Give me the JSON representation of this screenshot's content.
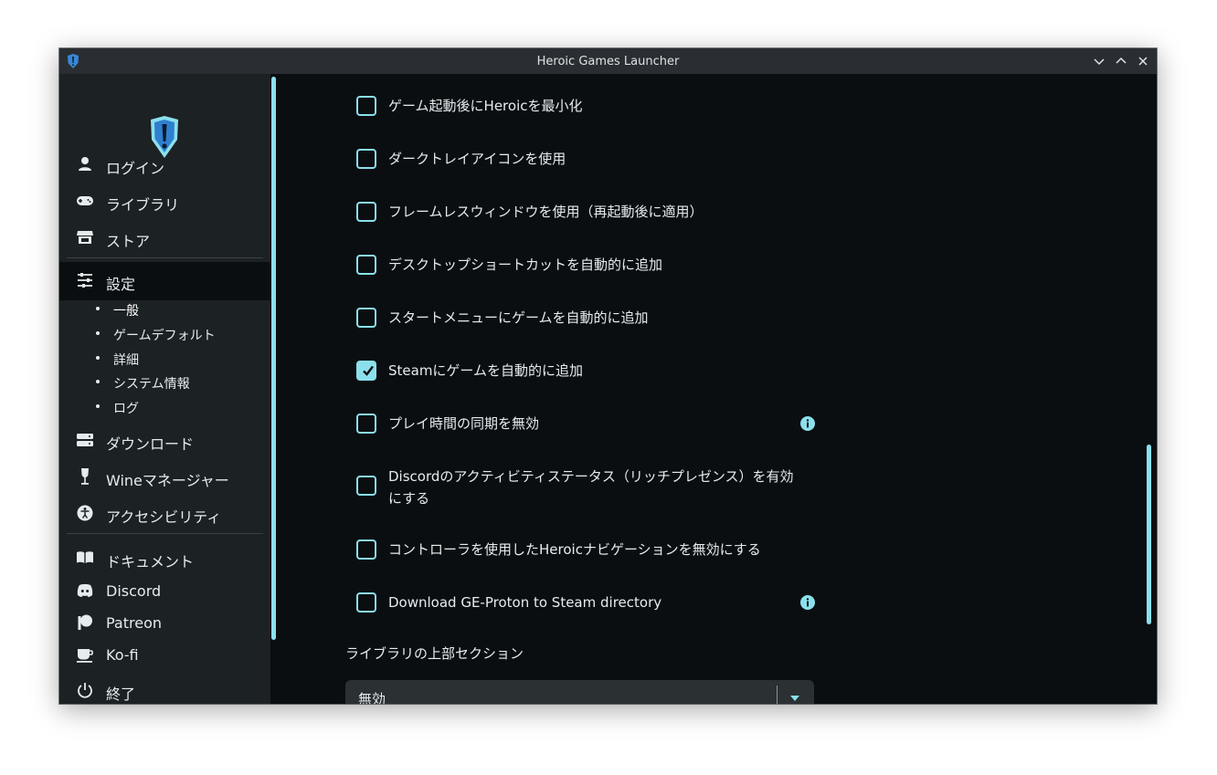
{
  "window": {
    "title": "Heroic Games Launcher",
    "app_icon": "heroic-shield-icon",
    "controls": [
      "minimize-icon",
      "maximize-icon",
      "close-icon"
    ]
  },
  "colors": {
    "accent": "#8be0ec",
    "sidebar_bg": "#1c2123",
    "main_bg": "#0b0e11",
    "titlebar_bg": "#2a2e32",
    "text": "#e6ecee"
  },
  "sidebar": {
    "logo": "heroic-logo-icon",
    "nav": [
      {
        "label": "ログイン",
        "icon": "user-icon"
      },
      {
        "label": "ライブラリ",
        "icon": "gamepad-icon"
      },
      {
        "label": "ストア",
        "icon": "store-icon"
      },
      {
        "label": "設定",
        "icon": "sliders-icon",
        "active": true
      }
    ],
    "settings_sub": [
      {
        "label": "一般",
        "active": true
      },
      {
        "label": "ゲームデフォルト"
      },
      {
        "label": "詳細"
      },
      {
        "label": "システム情報"
      },
      {
        "label": "ログ"
      }
    ],
    "nav2": [
      {
        "label": "ダウンロード",
        "icon": "download-drive-icon"
      },
      {
        "label": "Wineマネージャー",
        "icon": "wine-glass-icon"
      },
      {
        "label": "アクセシビリティ",
        "icon": "accessibility-icon"
      }
    ],
    "links": [
      {
        "label": "ドキュメント",
        "icon": "book-icon"
      },
      {
        "label": "Discord",
        "icon": "discord-icon"
      },
      {
        "label": "Patreon",
        "icon": "patreon-icon"
      },
      {
        "label": "Ko-fi",
        "icon": "coffee-cup-icon"
      },
      {
        "label": "終了",
        "icon": "power-icon"
      }
    ]
  },
  "settings": {
    "options": [
      {
        "label": "ゲーム起動後にHeroicを最小化",
        "checked": false
      },
      {
        "label": "ダークトレイアイコンを使用",
        "checked": false
      },
      {
        "label": "フレームレスウィンドウを使用（再起動後に適用）",
        "checked": false
      },
      {
        "label": "デスクトップショートカットを自動的に追加",
        "checked": false
      },
      {
        "label": "スタートメニューにゲームを自動的に追加",
        "checked": false
      },
      {
        "label": "Steamにゲームを自動的に追加",
        "checked": true
      },
      {
        "label": "プレイ時間の同期を無効",
        "checked": false,
        "info": true
      },
      {
        "label_line1": "Discordのアクティビティステータス（リッチプレゼンス）を有効",
        "label_line2": "にする",
        "checked": false
      },
      {
        "label": "コントローラを使用したHeroicナビゲーションを無効にする",
        "checked": false
      },
      {
        "label": "Download GE-Proton to Steam directory",
        "checked": false,
        "info": true
      }
    ],
    "library_top_section": {
      "title": "ライブラリの上部セクション",
      "value": "無効"
    }
  }
}
